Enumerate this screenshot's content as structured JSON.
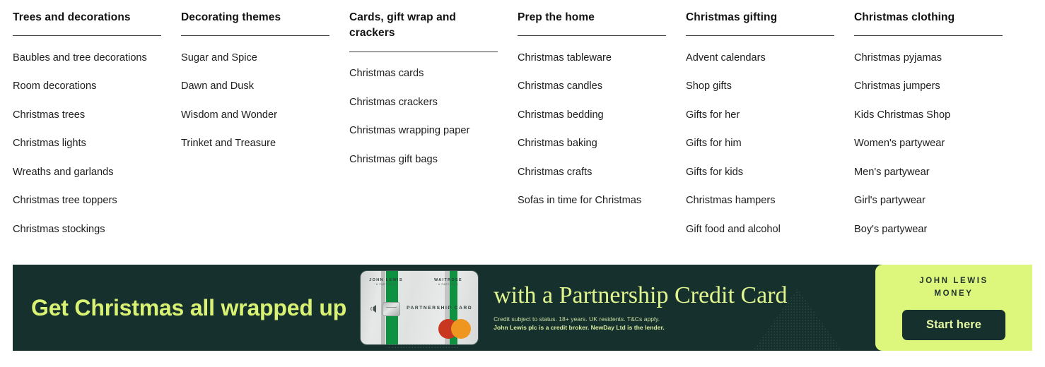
{
  "menu": {
    "columns": [
      {
        "heading": "Trees and decorations",
        "links": [
          "Baubles and tree decorations",
          "Room decorations",
          "Christmas trees",
          "Christmas lights",
          "Wreaths and garlands",
          "Christmas tree toppers",
          "Christmas stockings"
        ]
      },
      {
        "heading": "Decorating themes",
        "links": [
          "Sugar and Spice",
          "Dawn and Dusk",
          "Wisdom and Wonder",
          "Trinket and Treasure"
        ]
      },
      {
        "heading": "Cards, gift wrap and crackers",
        "links": [
          "Christmas cards",
          "Christmas crackers",
          "Christmas wrapping paper",
          "Christmas gift bags"
        ]
      },
      {
        "heading": "Prep the home",
        "links": [
          "Christmas tableware",
          "Christmas candles",
          "Christmas bedding",
          "Christmas baking",
          "Christmas crafts",
          "Sofas in time for Christmas"
        ]
      },
      {
        "heading": "Christmas gifting",
        "links": [
          "Advent calendars",
          "Shop gifts",
          "Gifts for her",
          "Gifts for him",
          "Gifts for kids",
          "Christmas hampers",
          "Gift food and alcohol"
        ]
      },
      {
        "heading": "Christmas clothing",
        "links": [
          "Christmas pyjamas",
          "Christmas jumpers",
          "Kids Christmas Shop",
          "Women's partywear",
          "Men's partywear",
          "Girl's partywear",
          "Boy's partywear"
        ]
      }
    ]
  },
  "banner": {
    "headline": "Get Christmas all wrapped up",
    "subheadline": "with a Partnership Credit Card",
    "disclaimer_line1": "Credit subject to status. 18+ years. UK residents. T&Cs apply.",
    "disclaimer_line2": "John Lewis plc is a credit broker. NewDay Ltd is the lender.",
    "card": {
      "brand_left_main": "JOHN LEWIS",
      "brand_left_sub": "& PARTNERS",
      "brand_right_main": "WAITROSE",
      "brand_right_sub": "& PARTNERS",
      "card_type": "PARTNERSHIP CARD"
    },
    "cta": {
      "logo_line1": "JOHN LEWIS",
      "logo_line2": "MONEY",
      "button_label": "Start here"
    },
    "colors": {
      "background": "#16302e",
      "headline": "#d9f274",
      "serif_headline": "#e1f58e",
      "panel": "#ddf67c",
      "button_bg": "#16302e",
      "button_text": "#e6f9a3"
    }
  }
}
